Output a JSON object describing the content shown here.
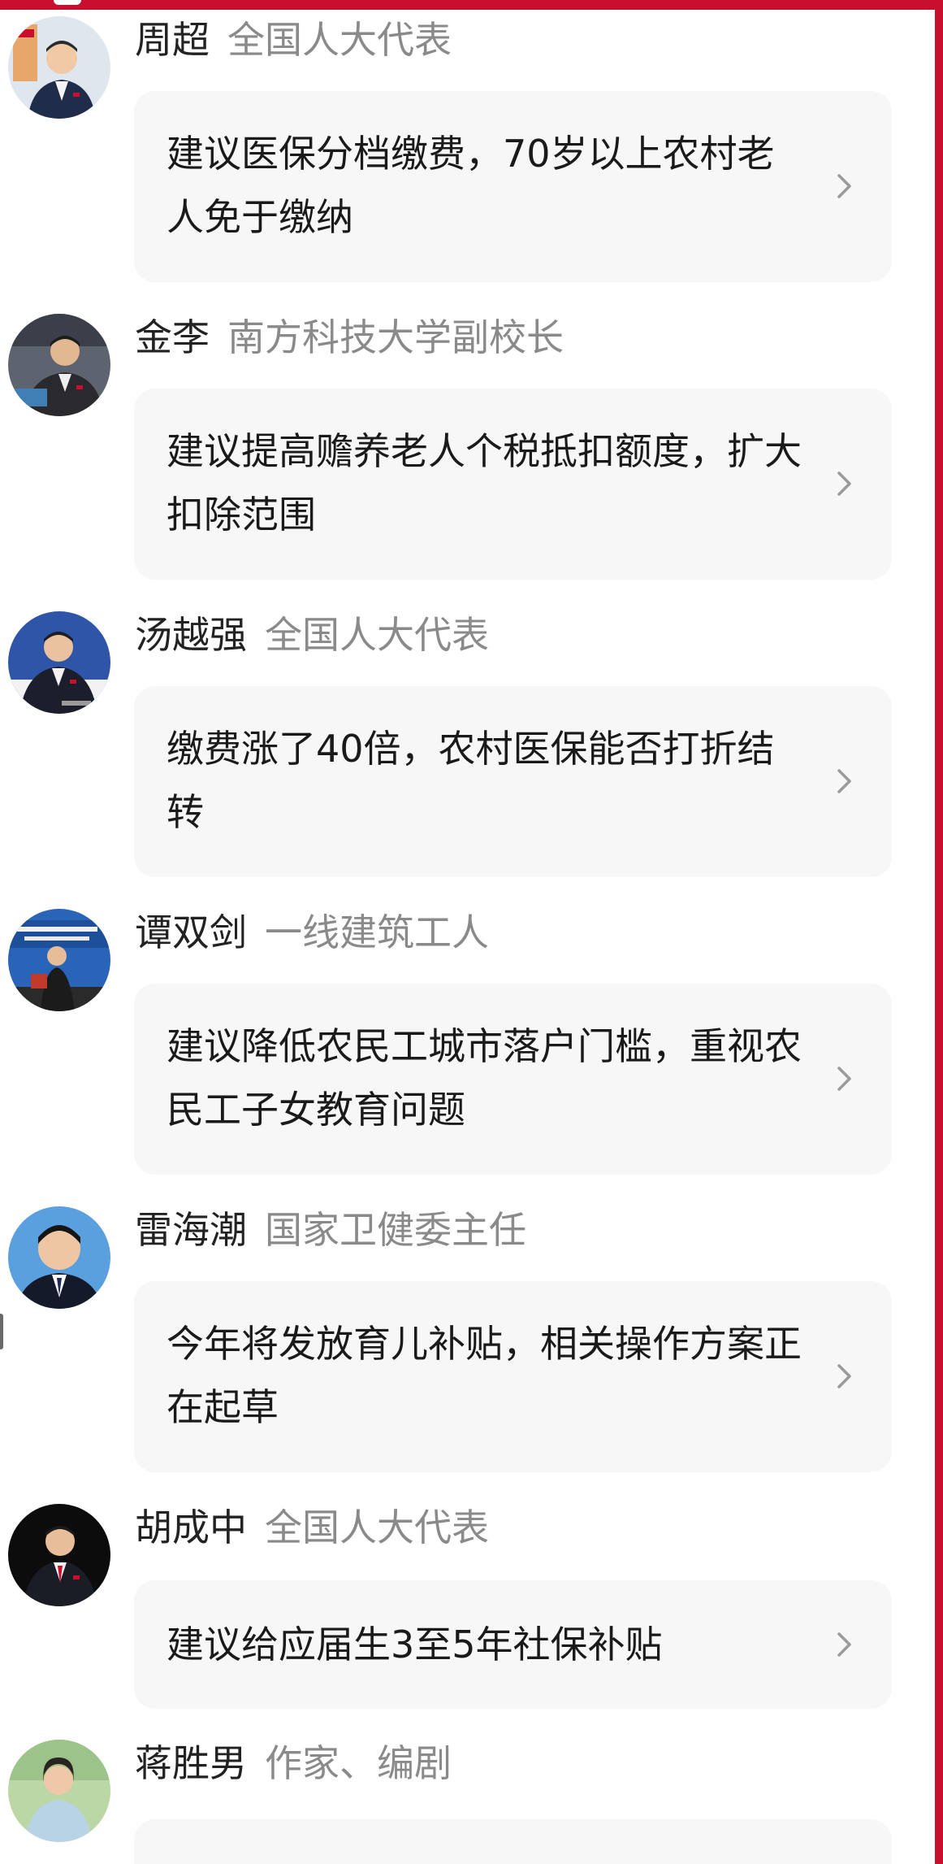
{
  "theme": {
    "accent": "#c8102e",
    "name_color": "#222222",
    "title_color": "#8a8a8a",
    "card_bg": "#f7f7f7",
    "chevron_color": "#9a9a9a"
  },
  "entries": [
    {
      "name": "周超",
      "title": "全国人大代表",
      "text": "建议医保分档缴费，70岁以上农村老人免于缴纳",
      "avatar_icon": "person-portrait-icon"
    },
    {
      "name": "金李",
      "title": "南方科技大学副校长",
      "text": "建议提高赡养老人个税抵扣额度，扩大扣除范围",
      "avatar_icon": "person-portrait-icon"
    },
    {
      "name": "汤越强",
      "title": "全国人大代表",
      "text": "缴费涨了40倍，农村医保能否打折结转",
      "avatar_icon": "person-portrait-icon"
    },
    {
      "name": "谭双剑",
      "title": "一线建筑工人",
      "text": "建议降低农民工城市落户门槛，重视农民工子女教育问题",
      "avatar_icon": "person-portrait-icon"
    },
    {
      "name": "雷海潮",
      "title": "国家卫健委主任",
      "text": "今年将发放育儿补贴，相关操作方案正在起草",
      "avatar_icon": "person-portrait-icon"
    },
    {
      "name": "胡成中",
      "title": "全国人大代表",
      "text": "建议给应届生3至5年社保补贴",
      "avatar_icon": "person-portrait-icon"
    },
    {
      "name": "蒋胜男",
      "title": "作家、编剧",
      "text": "",
      "avatar_icon": "person-portrait-icon"
    }
  ]
}
